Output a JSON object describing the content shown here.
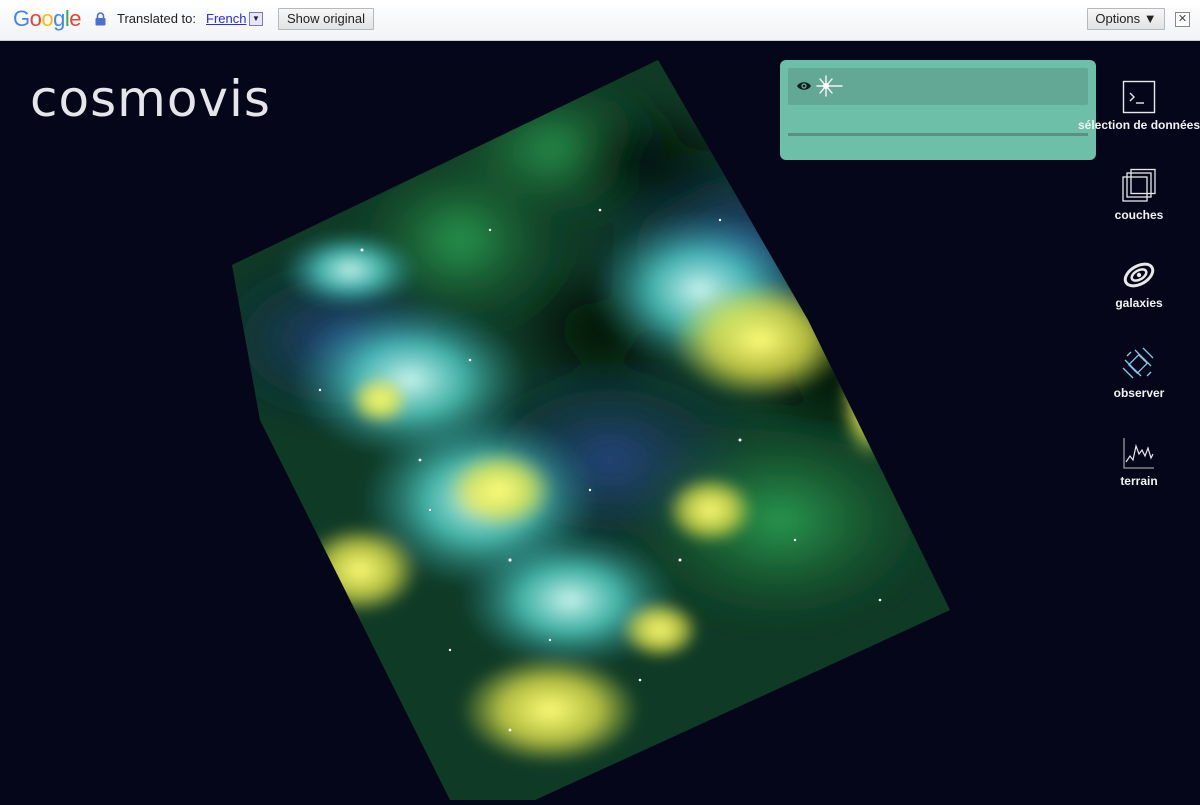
{
  "translate_bar": {
    "brand": "Google",
    "translated_to_label": "Translated to:",
    "language": "French",
    "show_original_label": "Show original",
    "options_label": "Options ▼",
    "close_glyph": "✕",
    "dropdown_glyph": "▼"
  },
  "app": {
    "title": "cosmovis"
  },
  "layer_panel": {
    "row": {
      "visibility_icon": "eye-icon",
      "layer_icon": "star-sparkle-icon"
    }
  },
  "toolbar": {
    "items": [
      {
        "label": "sélection de données",
        "icon": "terminal-icon"
      },
      {
        "label": "couches",
        "icon": "layers-icon"
      },
      {
        "label": "galaxies",
        "icon": "galaxy-icon"
      },
      {
        "label": "observer",
        "icon": "satellite-icon"
      },
      {
        "label": "terrain",
        "icon": "terrain-chart-icon"
      }
    ]
  },
  "colors": {
    "background": "#06061a",
    "panel": "#6dbfa7",
    "panel_row": "#63a895",
    "accent_cyan": "#6ff0ea",
    "accent_yellow": "#f2f04a",
    "accent_green": "#1f7a3a"
  }
}
